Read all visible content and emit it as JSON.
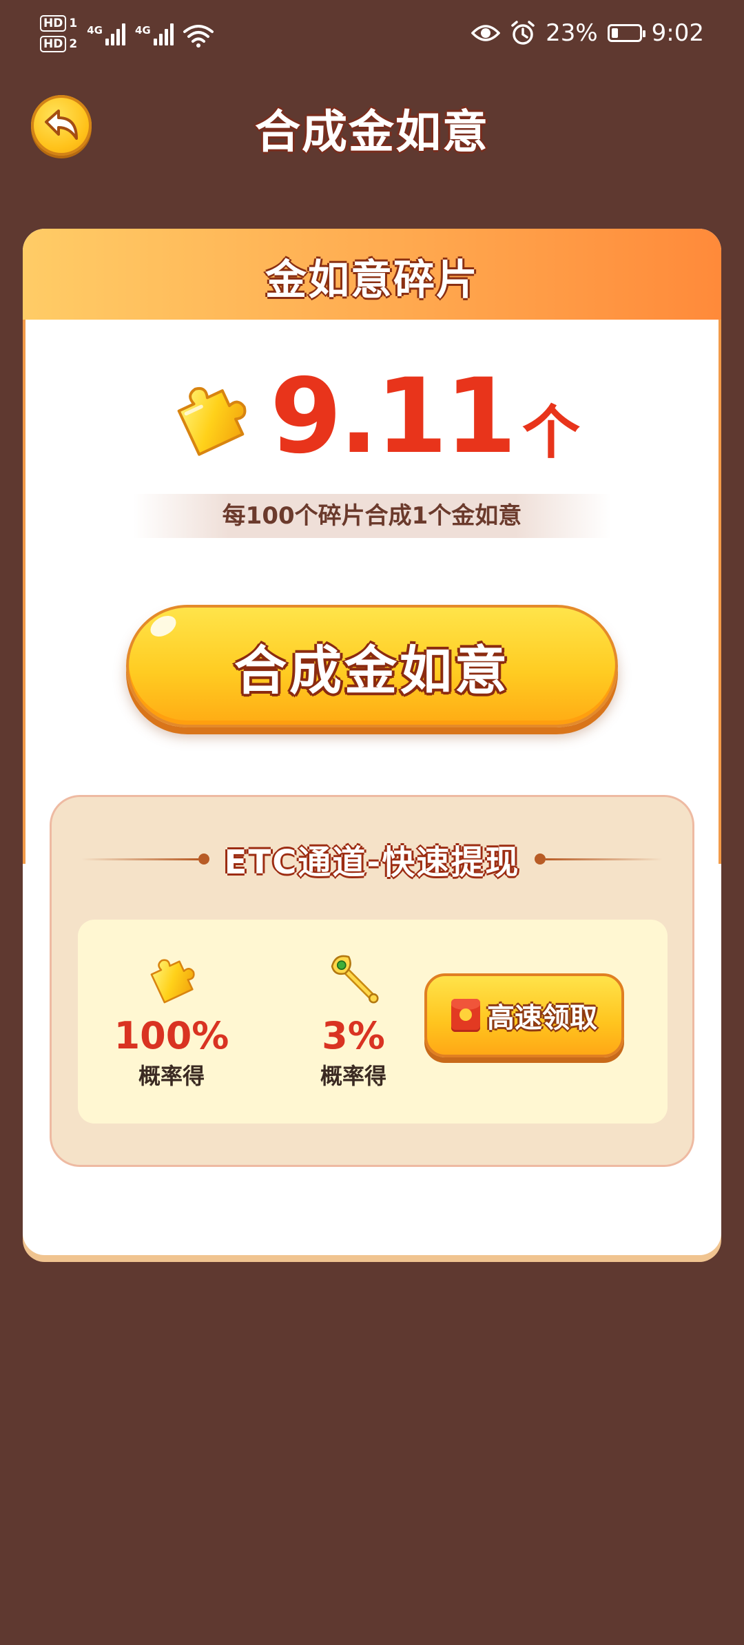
{
  "status_bar": {
    "sim1_label": "HD",
    "sim1_num": "1",
    "sim2_label": "HD",
    "sim2_num": "2",
    "net1": "4G",
    "net2": "4G",
    "battery_percent": "23%",
    "battery_level": 0.23,
    "time": "9:02",
    "icons": [
      "eye-icon",
      "alarm-icon",
      "battery-icon",
      "wifi-icon",
      "signal-icon"
    ]
  },
  "header": {
    "title": "合成金如意",
    "back_icon": "back-arrow-icon"
  },
  "card": {
    "header_title": "金如意碎片",
    "count": "9.11",
    "unit": "个",
    "rule": "每100个碎片合成1个金如意",
    "merge_button": "合成金如意"
  },
  "etc": {
    "title": "ETC通道-快速提现",
    "rewards": [
      {
        "icon": "puzzle-piece-icon",
        "percent": "100%",
        "label": "概率得"
      },
      {
        "icon": "ruyi-scepter-icon",
        "percent": "3%",
        "label": "概率得"
      }
    ],
    "claim_button": "高速领取",
    "claim_icon": "red-envelope-icon"
  },
  "colors": {
    "background": "#5f3930",
    "accent_red": "#e8341b",
    "button_yellow": "#ffcc22"
  }
}
